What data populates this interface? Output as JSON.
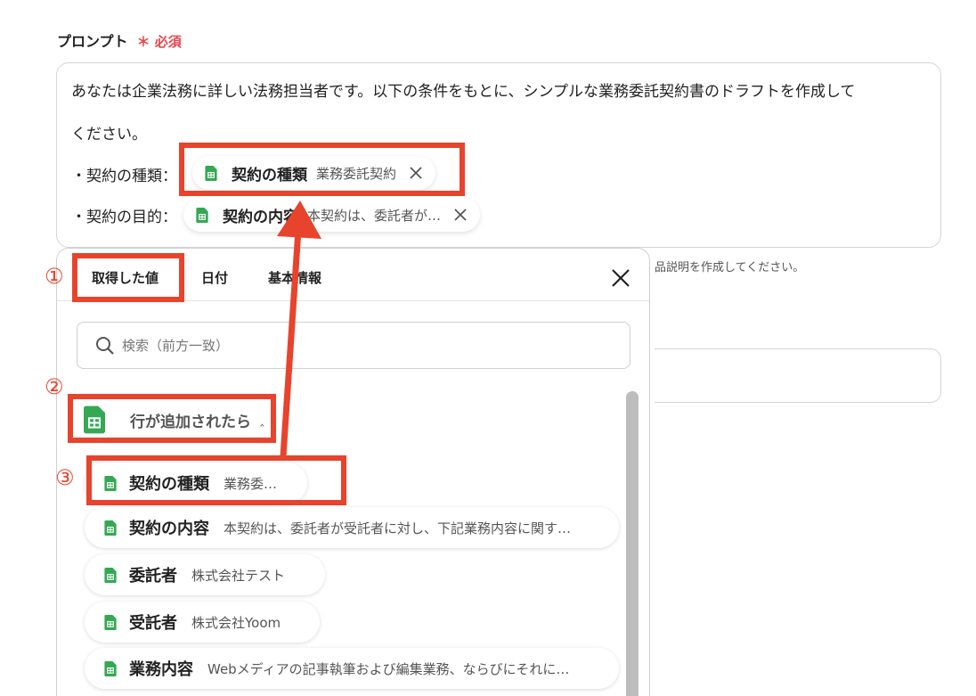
{
  "field": {
    "label": "プロンプト",
    "required_mark": "＊",
    "required_text": "必須"
  },
  "prompt": {
    "line1": "あなたは企業法務に詳しい法務担当者です。以下の条件をもとに、シンプルな業務委託契約書のドラフトを作成して",
    "line2": "ください。",
    "line3_label": "・契約の種類：",
    "line4_label": "・契約の目的：",
    "chip1": {
      "name": "契約の種類",
      "value": "業務委託契約",
      "icon": "sheets-icon"
    },
    "chip2": {
      "name": "契約の内容",
      "value": "本契約は、委託者が…",
      "icon": "sheets-icon"
    }
  },
  "hint": "品説明を作成してください。",
  "panel": {
    "tabs": [
      "取得した値",
      "日付",
      "基本情報"
    ],
    "search_placeholder": "検索（前方一致）",
    "group_label": "行が追加されたら",
    "group_caret": "‸",
    "items": [
      {
        "name": "契約の種類",
        "value": "業務委託契約"
      },
      {
        "name": "契約の内容",
        "value": "本契約は、委託者が受託者に対し、下記業務内容に関す…"
      },
      {
        "name": "委託者",
        "value": "株式会社テスト"
      },
      {
        "name": "受託者",
        "value": "株式会社Yoom"
      },
      {
        "name": "業務内容",
        "value": "Webメディアの記事執筆および編集業務、ならびにそれに…"
      }
    ]
  },
  "annotations": {
    "step1": "①",
    "step2": "②",
    "step3": "③"
  },
  "colors": {
    "accent": "#e8432c",
    "required": "#e5484d",
    "sheets_green": "#34a853"
  }
}
